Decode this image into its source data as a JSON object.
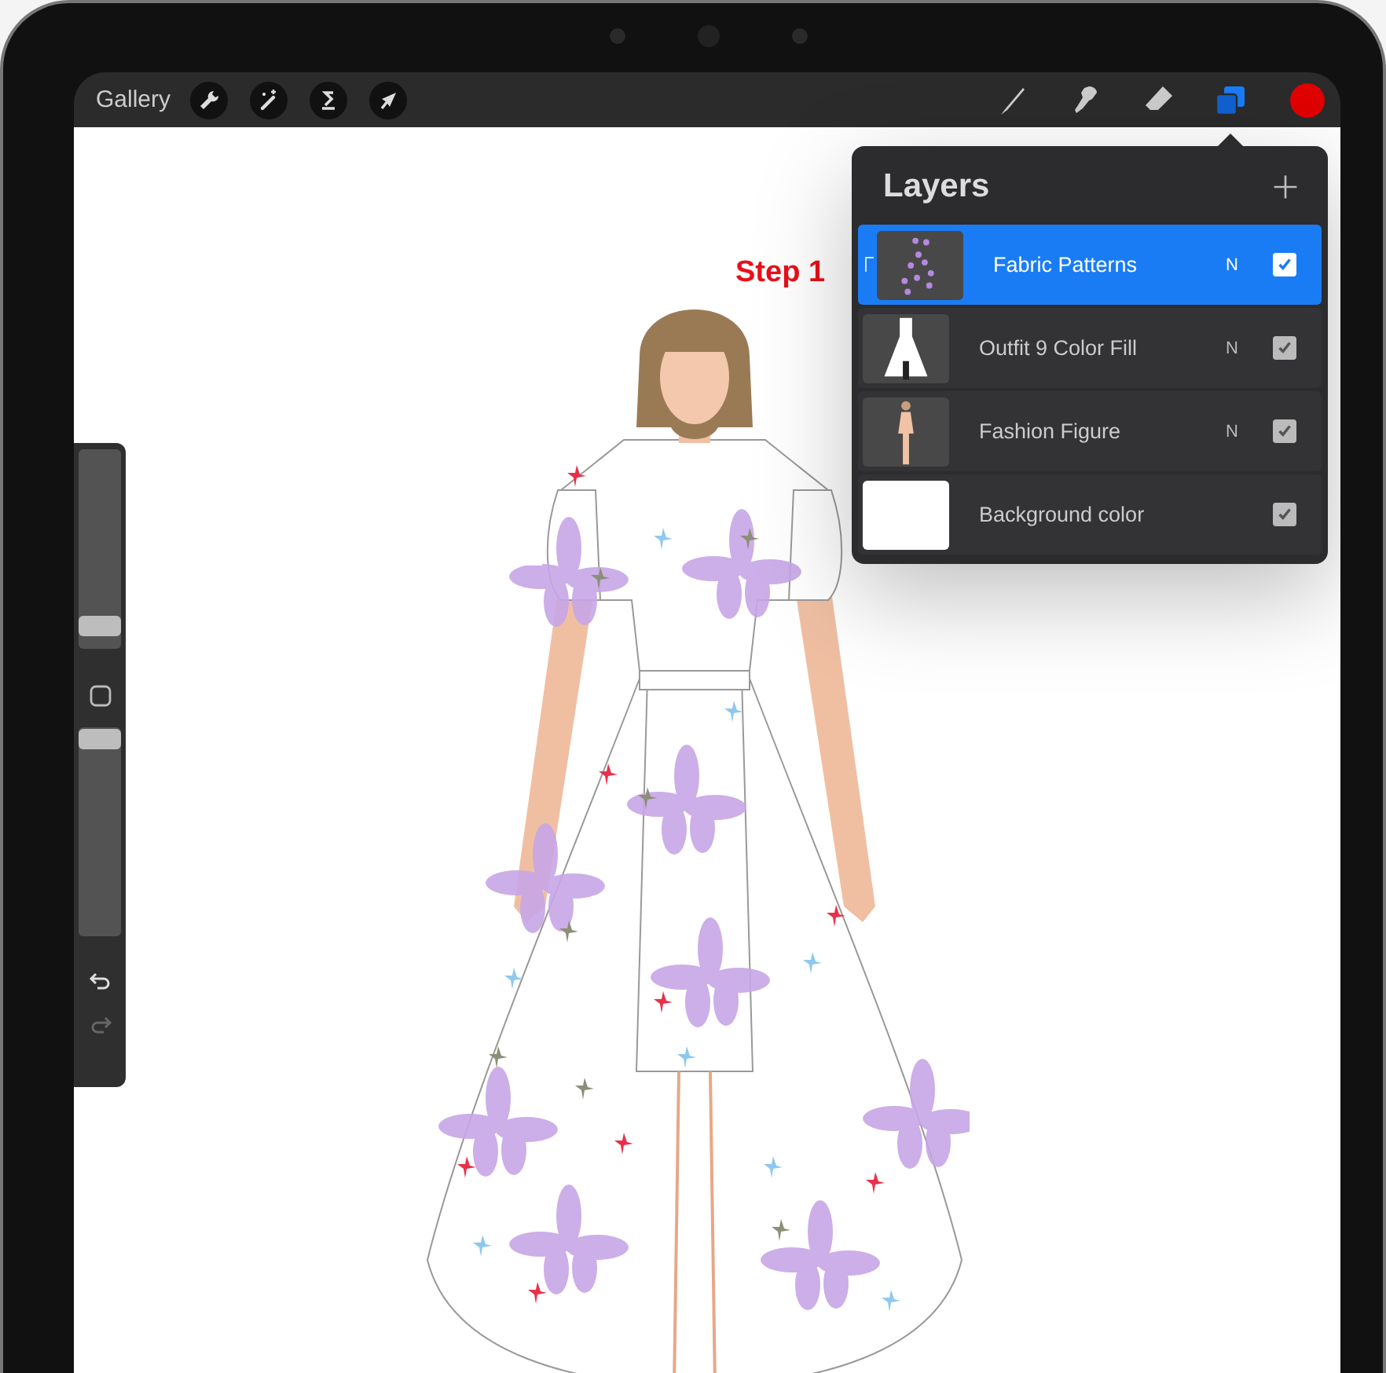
{
  "toolbar": {
    "gallery": "Gallery",
    "left_tools": [
      {
        "kind": "wrench"
      },
      {
        "kind": "wand"
      },
      {
        "kind": "selection"
      },
      {
        "kind": "transform"
      }
    ],
    "right_tools": [
      {
        "kind": "brush",
        "selected": false
      },
      {
        "kind": "smudge",
        "selected": false
      },
      {
        "kind": "eraser",
        "selected": false
      },
      {
        "kind": "layers",
        "selected": true
      }
    ],
    "color_swatch": {
      "color": "#e00000"
    }
  },
  "sidebar": {
    "sliders": [
      {
        "level": 0.12
      },
      {
        "level": 0.95
      }
    ]
  },
  "annotation": "Step 1",
  "layers_panel": {
    "title": "Layers",
    "layers": [
      {
        "name": "Fabric Patterns",
        "blend": "N",
        "visible": true,
        "selected": true,
        "clipping": true,
        "kind": "pattern"
      },
      {
        "name": "Outfit 9 Color Fill",
        "blend": "N",
        "visible": true,
        "selected": false,
        "clipping": false,
        "kind": "dress"
      },
      {
        "name": "Fashion Figure",
        "blend": "N",
        "visible": true,
        "selected": false,
        "clipping": false,
        "kind": "figure"
      },
      {
        "name": "Background color",
        "visible": true,
        "selected": false,
        "clipping": false,
        "kind": "background"
      }
    ]
  }
}
